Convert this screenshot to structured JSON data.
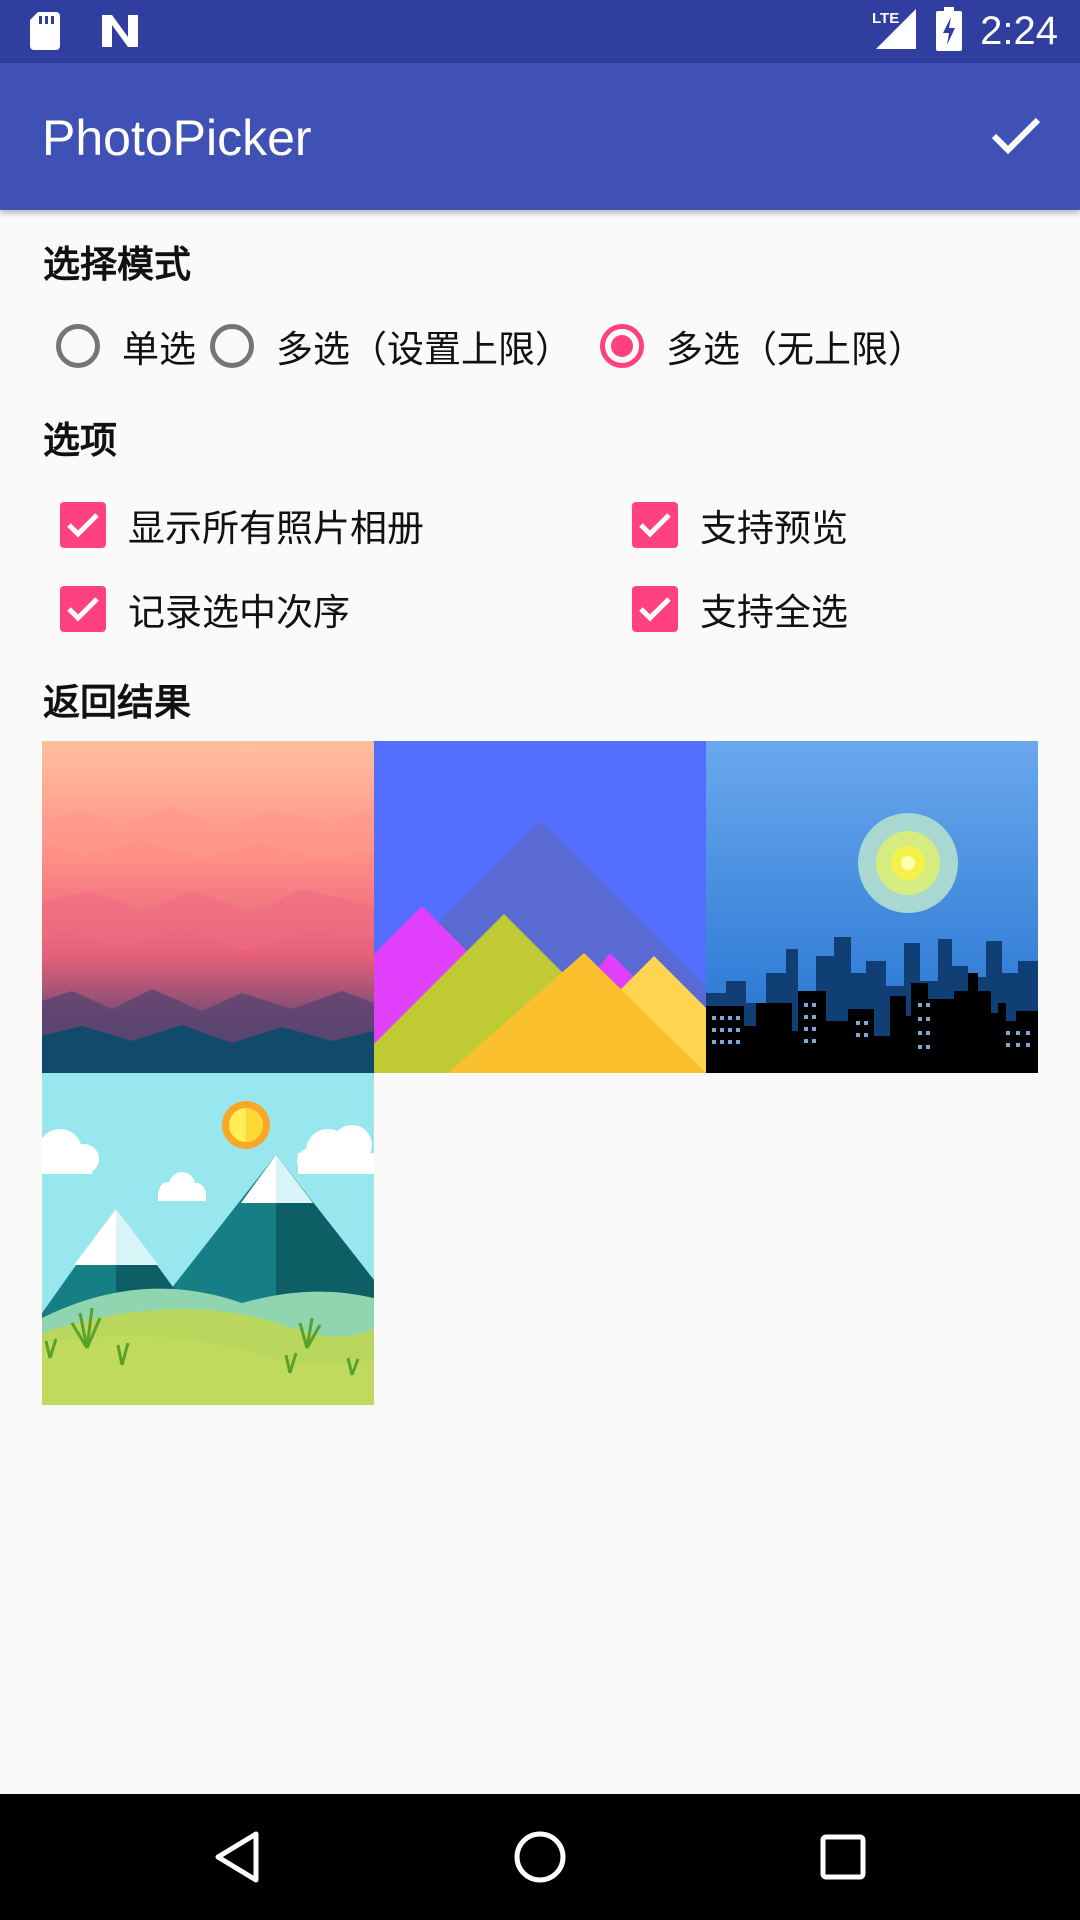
{
  "status_bar": {
    "time": "2:24",
    "network": "LTE",
    "icons": [
      "sd-card-icon",
      "n-logo-icon",
      "lte-signal-icon",
      "battery-charging-icon"
    ]
  },
  "app_bar": {
    "title": "PhotoPicker",
    "action_icon": "check-icon"
  },
  "mode_section": {
    "label": "选择模式",
    "options": [
      {
        "label": "单选",
        "selected": false
      },
      {
        "label": "多选（设置上限）",
        "selected": false
      },
      {
        "label": "多选（无上限）",
        "selected": true
      }
    ]
  },
  "options_section": {
    "label": "选项",
    "items": [
      {
        "label": "显示所有照片相册",
        "checked": true
      },
      {
        "label": "支持预览",
        "checked": true
      },
      {
        "label": "记录选中次序",
        "checked": true
      },
      {
        "label": "支持全选",
        "checked": true
      }
    ]
  },
  "result_section": {
    "label": "返回结果",
    "photos": [
      "polygon-sunset-wallpaper",
      "material-mountains-wallpaper",
      "city-skyline-night-wallpaper",
      "cartoon-mountains-wallpaper"
    ]
  },
  "colors": {
    "status_bar": "#303f9f",
    "app_bar": "#3f51b5",
    "accent": "#ff4081",
    "background": "#fafafa"
  },
  "nav_bar": {
    "icons": [
      "back-icon",
      "home-icon",
      "recents-icon"
    ]
  }
}
